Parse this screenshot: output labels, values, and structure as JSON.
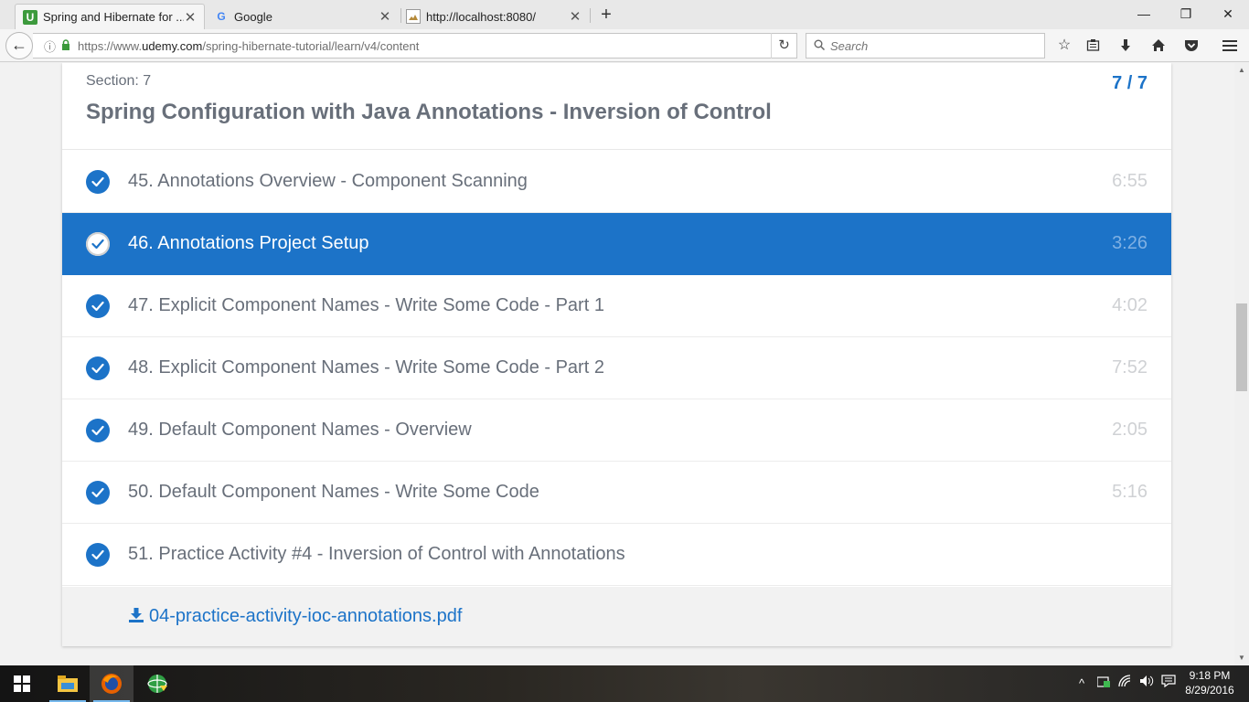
{
  "browser": {
    "tabs": [
      {
        "title": "Spring and Hibernate for ...",
        "favicon": "udemy-icon",
        "active": true
      },
      {
        "title": "Google",
        "favicon": "google-icon",
        "active": false
      },
      {
        "title": "http://localhost:8080/",
        "favicon": "broken-image-icon",
        "active": false
      }
    ],
    "new_tab": "+",
    "window_controls": {
      "minimize": "—",
      "restore": "❐",
      "close": "✕"
    },
    "url": {
      "prefix": "https://www.",
      "domain": "udemy.com",
      "path": "/spring-hibernate-tutorial/learn/v4/content"
    },
    "search_placeholder": "Search"
  },
  "section": {
    "label": "Section: 7",
    "title": "Spring Configuration with Java Annotations - Inversion of Control",
    "progress": "7 / 7"
  },
  "lectures": [
    {
      "title": "45. Annotations Overview - Component Scanning",
      "duration": "6:55",
      "completed": true,
      "current": false
    },
    {
      "title": "46. Annotations Project Setup",
      "duration": "3:26",
      "completed": true,
      "current": true
    },
    {
      "title": "47. Explicit Component Names - Write Some Code - Part 1",
      "duration": "4:02",
      "completed": true,
      "current": false
    },
    {
      "title": "48. Explicit Component Names - Write Some Code - Part 2",
      "duration": "7:52",
      "completed": true,
      "current": false
    },
    {
      "title": "49. Default Component Names - Overview",
      "duration": "2:05",
      "completed": true,
      "current": false
    },
    {
      "title": "50. Default Component Names - Write Some Code",
      "duration": "5:16",
      "completed": true,
      "current": false
    },
    {
      "title": "51. Practice Activity #4 - Inversion of Control with Annotations",
      "duration": "",
      "completed": true,
      "current": false
    }
  ],
  "resource": {
    "name": "04-practice-activity-ioc-annotations.pdf"
  },
  "taskbar": {
    "clock_time": "9:18 PM",
    "clock_date": "8/29/2016"
  },
  "colors": {
    "accent": "#1c73c8",
    "text": "#686f7a",
    "duration": "#cfd1d4"
  }
}
